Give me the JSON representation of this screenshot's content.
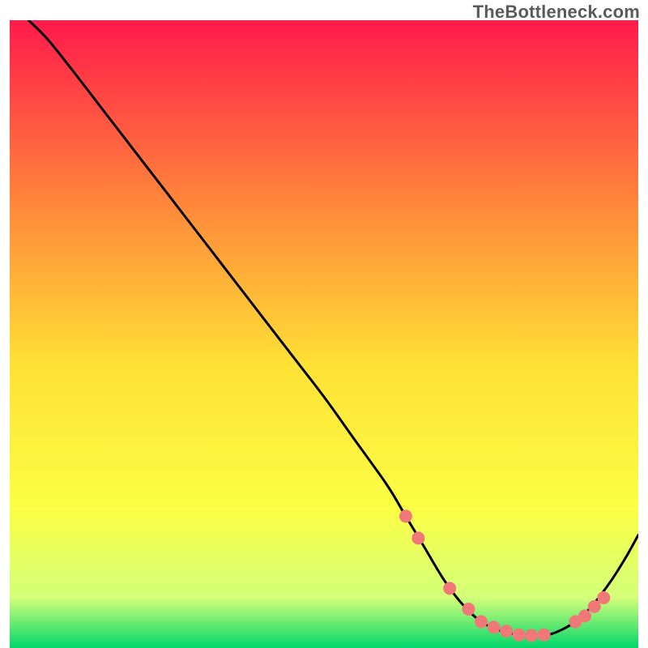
{
  "watermark": "TheBottleneck.com",
  "colors": {
    "grad_top": "#ff1a4b",
    "grad_mid_upper": "#ff8a3a",
    "grad_mid": "#ffe136",
    "grad_mid_lower": "#fbff45",
    "grad_lower": "#d3ff7a",
    "grad_bottom": "#00d66a",
    "curve": "#000000",
    "dot": "#f07878"
  },
  "chart_data": {
    "type": "line",
    "title": "",
    "xlabel": "",
    "ylabel": "",
    "xlim": [
      0,
      100
    ],
    "ylim": [
      0,
      100
    ],
    "curve_comment": "Single black curve. y≈100 near x=0, descends roughly linearly to a broad minimum ~y≈2 over x≈72–86, then rises to y≈18 at x=100. Values are estimated from unlabeled axes (0–100 normalized).",
    "series": [
      {
        "name": "curve",
        "x": [
          3,
          6,
          10,
          15,
          20,
          25,
          30,
          35,
          40,
          45,
          50,
          55,
          60,
          63,
          66,
          69,
          72,
          75,
          78,
          81,
          84,
          86,
          88,
          90,
          92,
          94,
          96,
          98,
          100
        ],
        "y": [
          100,
          97,
          92,
          85.5,
          79,
          72.5,
          66,
          59.5,
          53,
          46.5,
          40,
          33,
          26,
          21,
          16,
          11,
          7,
          4.2,
          2.8,
          2.1,
          2.0,
          2.2,
          3.0,
          4.2,
          6.0,
          8.4,
          11.2,
          14.4,
          18.0
        ]
      }
    ],
    "dots_comment": "Salmon dots placed along the curve near its flat bottom and on the ascending tail.",
    "dots": {
      "x": [
        63,
        65,
        70,
        73,
        75,
        77,
        79,
        81,
        83,
        85,
        90,
        91.5,
        93,
        94.5
      ],
      "y": [
        21,
        17.5,
        9.5,
        6.2,
        4.2,
        3.3,
        2.7,
        2.1,
        2.0,
        2.1,
        4.2,
        5.1,
        6.6,
        8.0
      ]
    }
  }
}
